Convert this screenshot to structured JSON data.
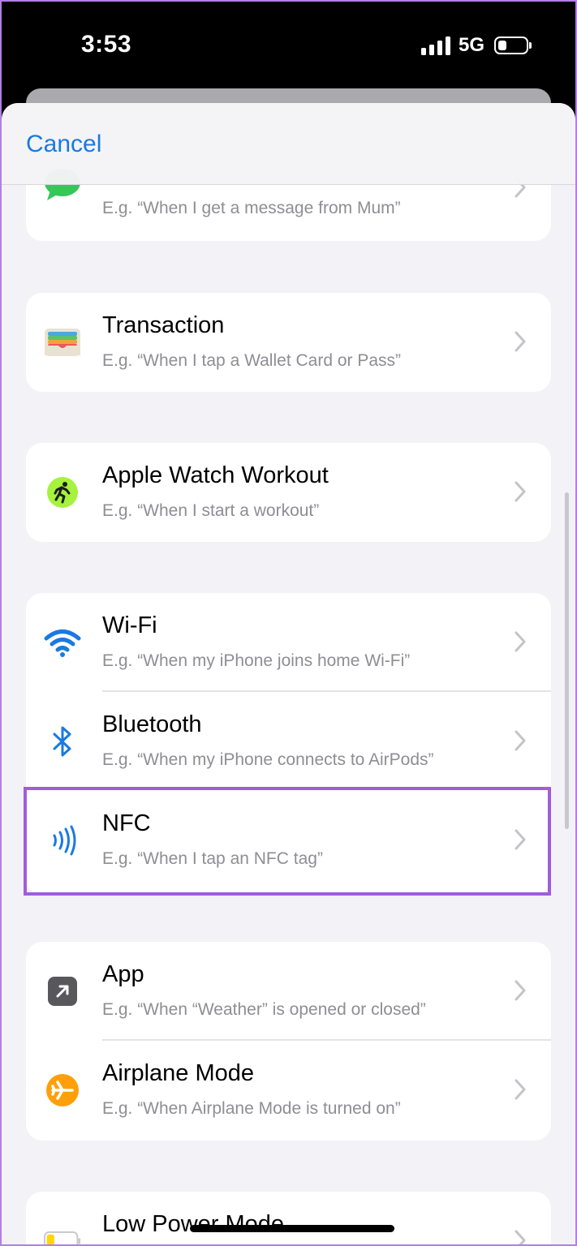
{
  "status": {
    "time": "3:53",
    "network": "5G"
  },
  "header": {
    "cancel_label": "Cancel"
  },
  "groups": [
    {
      "rows": [
        {
          "title": "",
          "subtitle": "E.g. “When I get a message from Mum”",
          "icon": "messages-icon",
          "color": "#34c759"
        }
      ]
    },
    {
      "rows": [
        {
          "title": "Transaction",
          "subtitle": "E.g. “When I tap a Wallet Card or Pass”",
          "icon": "wallet-icon"
        }
      ]
    },
    {
      "rows": [
        {
          "title": "Apple Watch Workout",
          "subtitle": "E.g. “When I start a workout”",
          "icon": "workout-icon",
          "color": "#a6f23d"
        }
      ]
    },
    {
      "rows": [
        {
          "title": "Wi-Fi",
          "subtitle": "E.g. “When my iPhone joins home Wi-Fi”",
          "icon": "wifi-icon",
          "color": "#1a7ae0"
        },
        {
          "title": "Bluetooth",
          "subtitle": "E.g. “When my iPhone connects to AirPods”",
          "icon": "bluetooth-icon",
          "color": "#1a7ae0"
        },
        {
          "title": "NFC",
          "subtitle": "E.g. “When I tap an NFC tag”",
          "icon": "nfc-icon",
          "color": "#1a7ae0"
        }
      ]
    },
    {
      "rows": [
        {
          "title": "App",
          "subtitle": "E.g. “When “Weather” is opened or closed”",
          "icon": "app-arrow-icon",
          "color": "#58585c"
        },
        {
          "title": "Airplane Mode",
          "subtitle": "E.g. “When Airplane Mode is turned on”",
          "icon": "airplane-icon",
          "color": "#ff9f0a"
        }
      ]
    },
    {
      "rows": [
        {
          "title": "Low Power Mode",
          "subtitle": "",
          "icon": "battery-low-icon",
          "color": "#ffd60a"
        }
      ]
    }
  ],
  "highlight_color": "#a15ddc"
}
